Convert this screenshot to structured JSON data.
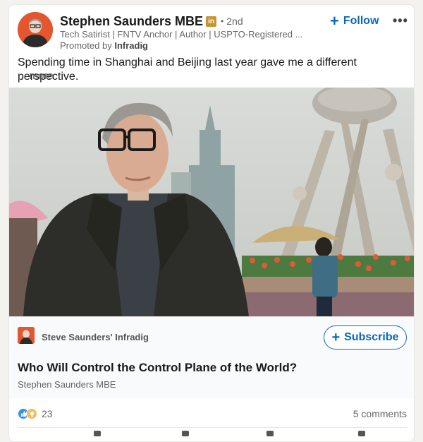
{
  "post": {
    "author_name": "Stephen Saunders MBE",
    "badge": "in",
    "separator": "•",
    "degree": "2nd",
    "headline": "Tech Satirist | FNTV Anchor | Author | USPTO-Registered ...",
    "promoted_prefix": "Promoted by",
    "promoted_by": "Infradig",
    "follow_label": "Follow",
    "more_menu": "•••",
    "text": "Spending time in Shanghai and Beijing last year gave me a different perspective.",
    "see_more": "... more"
  },
  "newsletter": {
    "name": "Steve Saunders' Infradig",
    "subscribe_label": "Subscribe",
    "article_title": "Who Will Control the Control Plane of the World?",
    "article_author": "Stephen Saunders MBE"
  },
  "social": {
    "reaction_count": "23",
    "comments": "5 comments"
  },
  "colors": {
    "accent": "#0a66c2",
    "badge": "#c5953a",
    "avatar_bg": "#e4572e"
  }
}
